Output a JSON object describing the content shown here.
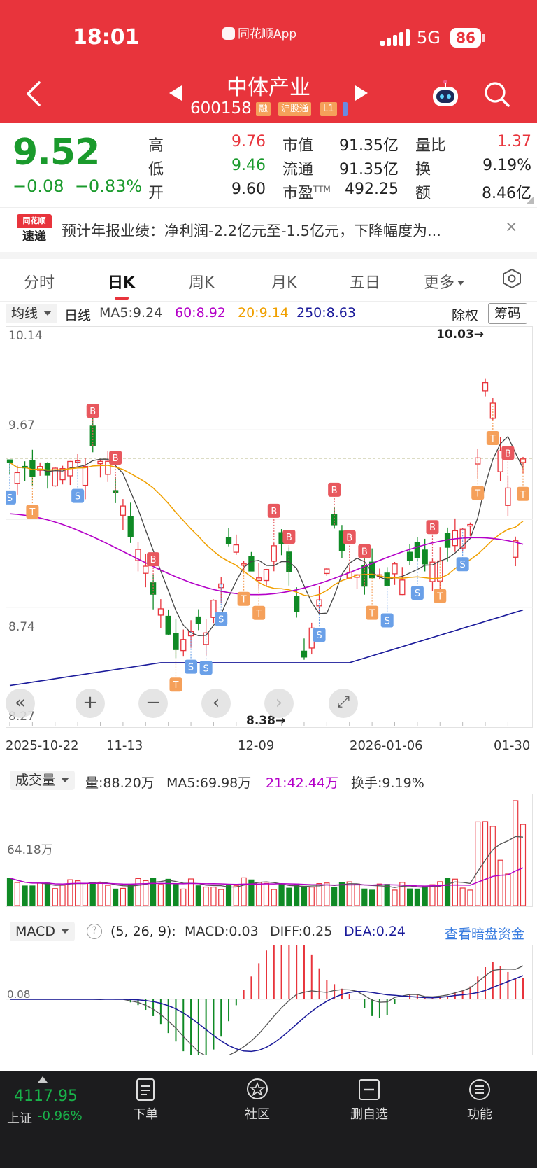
{
  "status_bar": {
    "time": "18:01",
    "app_name": "同花顺App",
    "network": "5G",
    "battery": "86"
  },
  "header": {
    "name": "中体产业",
    "code": "600158",
    "tags": [
      "融",
      "沪股通",
      "L1"
    ]
  },
  "quote": {
    "price": "9.52",
    "change": "−0.08",
    "change_pct": "−0.83%",
    "rows": [
      [
        {
          "label": "高",
          "value": "9.76",
          "color": "red"
        },
        {
          "label": "市值",
          "value": "91.35亿",
          "color": "dark"
        },
        {
          "label": "量比",
          "value": "1.37",
          "color": "red"
        }
      ],
      [
        {
          "label": "低",
          "value": "9.46",
          "color": "green"
        },
        {
          "label": "流通",
          "value": "91.35亿",
          "color": "dark"
        },
        {
          "label": "换",
          "value": "9.19%",
          "color": "dark"
        }
      ],
      [
        {
          "label": "开",
          "value": "9.60",
          "color": "dark"
        },
        {
          "label": "市盈",
          "value": "492.25",
          "color": "dark"
        },
        {
          "label": "额",
          "value": "8.46亿",
          "color": "dark"
        }
      ]
    ],
    "ttm": "TTM"
  },
  "news": {
    "logo_top": "同花顺",
    "logo_bottom": "速递",
    "text": "预计年报业绩：净利润-2.2亿元至-1.5亿元，下降幅度为...",
    "close": "×"
  },
  "tabs": [
    "分时",
    "日K",
    "周K",
    "月K",
    "五日",
    "更多"
  ],
  "kline": {
    "indicator_chip": "均线",
    "period": "日线",
    "ma": [
      {
        "label": "MA5:9.24",
        "color": "#444444"
      },
      {
        "label": "60:8.92",
        "color": "#b400c8"
      },
      {
        "label": "20:9.14",
        "color": "#f0a000"
      },
      {
        "label": "250:8.63",
        "color": "#1a1a9a"
      }
    ],
    "fq_label": "除权",
    "chip_btn": "筹码",
    "y_labels": [
      "10.14",
      "9.67",
      "8.74",
      "8.27"
    ],
    "high_mark": "10.03→",
    "low_mark": "8.38→",
    "dates": [
      "2025-10-22",
      "11-13",
      "12-09",
      "2026-01-06",
      "01-30"
    ]
  },
  "volume": {
    "chip": "成交量",
    "stats": [
      {
        "label": "量:88.20万",
        "color": "#333333"
      },
      {
        "label": "MA5:69.98万",
        "color": "#333333"
      },
      {
        "label": "21:42.44万",
        "color": "#b400c8"
      },
      {
        "label": "换手:9.19%",
        "color": "#333333"
      }
    ],
    "axis_label": "64.18万"
  },
  "macd": {
    "chip": "MACD",
    "help": "?",
    "params": "(5, 26, 9):",
    "macd_val": "MACD:0.03",
    "diff_val": "DIFF:0.25",
    "dea_val": "DEA:0.24",
    "link": "查看暗盘资金",
    "axis_label": "0.08"
  },
  "bottom_bar": {
    "index_value": "4117.95",
    "index_name": "上证",
    "index_pct": "-0.96%",
    "items": [
      "下单",
      "社区",
      "删自选",
      "功能"
    ]
  },
  "colors": {
    "brand_red": "#e8343c",
    "up": "#e8343c",
    "down": "#1a9a2c"
  }
}
